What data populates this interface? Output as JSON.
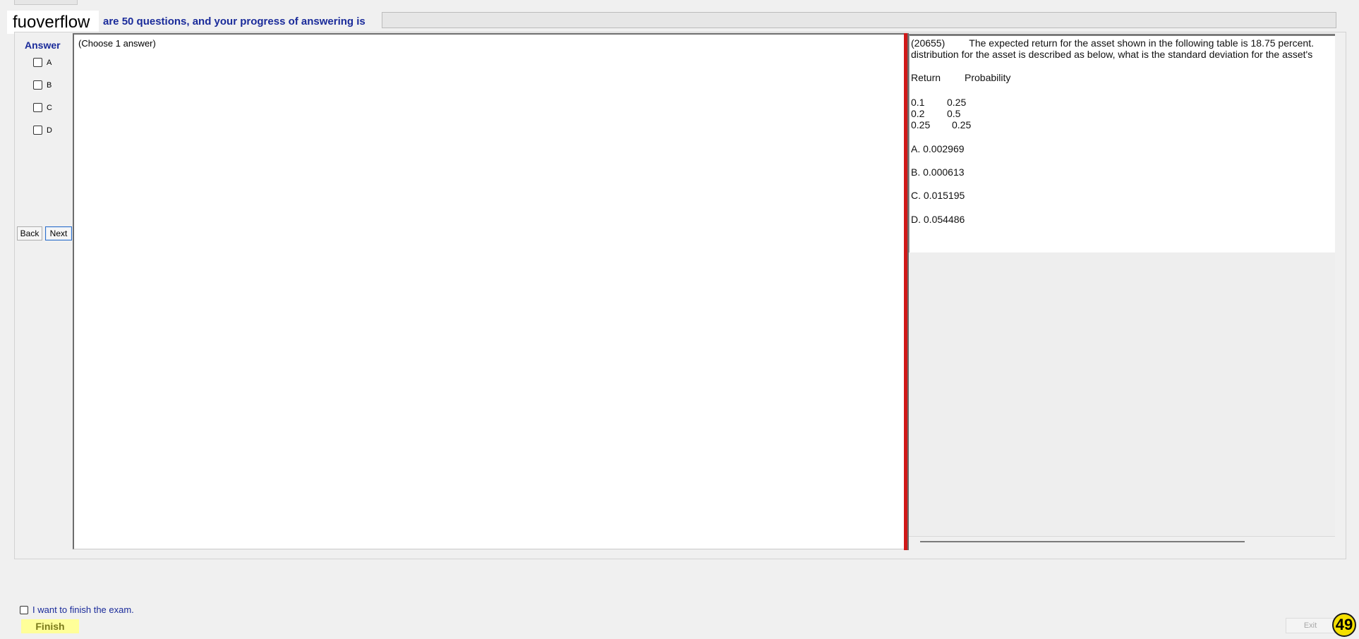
{
  "header": {
    "brand": "fuoverflow",
    "progress_label": "are 50 questions, and your progress of answering is",
    "progress_fraction": 0
  },
  "answer": {
    "title": "Answer",
    "options": [
      "A",
      "B",
      "C",
      "D"
    ],
    "back_label": "Back",
    "next_label": "Next",
    "hint": "(Choose 1 answer)"
  },
  "question": {
    "id": "(20655)",
    "line1": "The expected return for the asset shown in the following table is 18.75 percent.",
    "line2": "distribution for the asset is described as below, what is the standard deviation for the asset's",
    "table_header": [
      "Return",
      "Probability"
    ],
    "table_rows": [
      [
        "0.1",
        "0.25"
      ],
      [
        "0.2",
        "0.5"
      ],
      [
        "0.25",
        "0.25"
      ]
    ],
    "choices": [
      "A.  0.002969",
      "B.  0.000613",
      "C.  0.015195",
      "D.  0.054486"
    ]
  },
  "footer": {
    "finish_check_label": "I want to finish the exam.",
    "finish_label": "Finish",
    "exit_label": "Exit",
    "badge": "49"
  },
  "colors": {
    "accent_blue": "#1a2b9a",
    "splitter_red": "#d01818",
    "finish_yellow": "#ffff99",
    "badge_yellow": "#f5e000"
  }
}
